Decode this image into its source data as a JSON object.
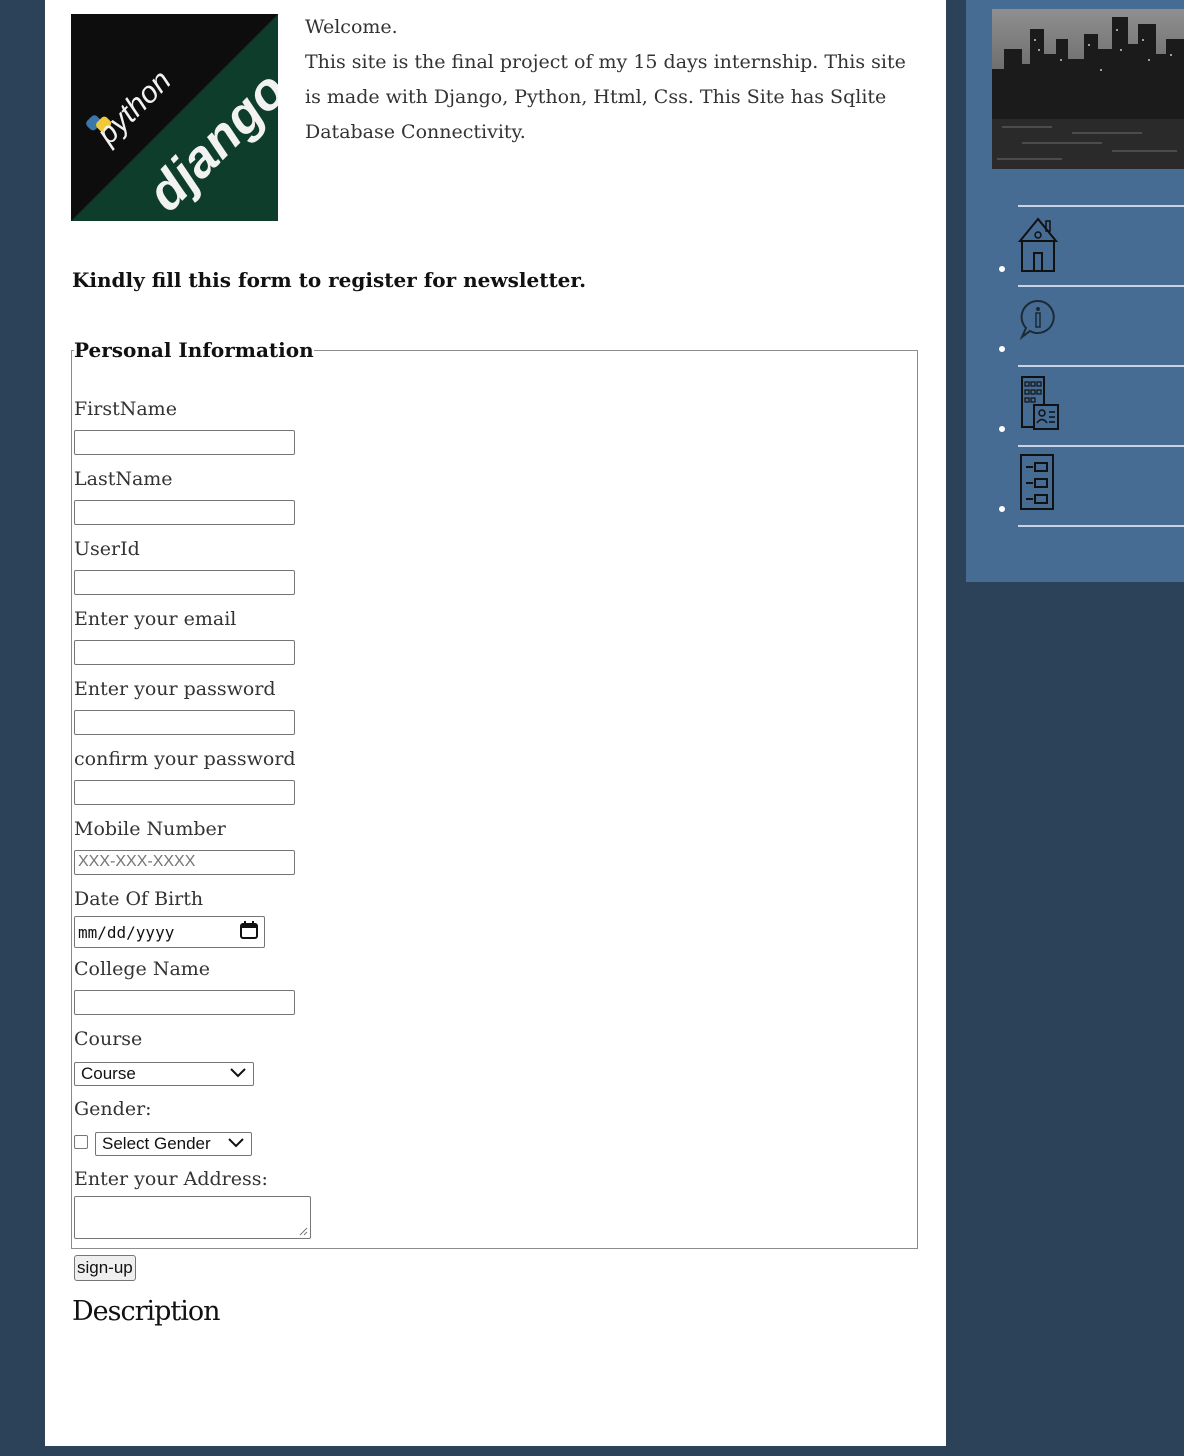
{
  "welcome": {
    "title": "Welcome.",
    "text": "This site is the final project of my 15 days internship. This site is made with Django, Python, Html, Css. This Site has Sqlite Database Connectivity."
  },
  "logo": {
    "word1": "python",
    "word2": "django"
  },
  "form": {
    "intro": "Kindly fill this form to register for newsletter.",
    "legend": "Personal Information",
    "first_name_label": "FirstName",
    "last_name_label": "LastName",
    "user_id_label": "UserId",
    "email_label": "Enter your email",
    "password_label": "Enter your password",
    "confirm_label": "confirm your password",
    "mobile_label": "Mobile Number",
    "mobile_placeholder": "XXX-XXX-XXXX",
    "dob_label": "Date Of Birth",
    "dob_placeholder": "mm/dd/yyyy",
    "college_label": "College Name",
    "course_label": "Course",
    "course_selected": "Course",
    "gender_label": "Gender:",
    "gender_selected": "Select Gender",
    "address_label": "Enter your Address:",
    "submit_label": "sign-up"
  },
  "description_heading": "Description",
  "sidebar": {
    "items": [
      {
        "icon": "home-icon"
      },
      {
        "icon": "info-icon"
      },
      {
        "icon": "building-contact-icon"
      },
      {
        "icon": "sitemap-icon"
      }
    ]
  },
  "colors": {
    "page_bg": "#2b4259",
    "sidebar_bg": "#476c93",
    "content_bg": "#ffffff"
  }
}
